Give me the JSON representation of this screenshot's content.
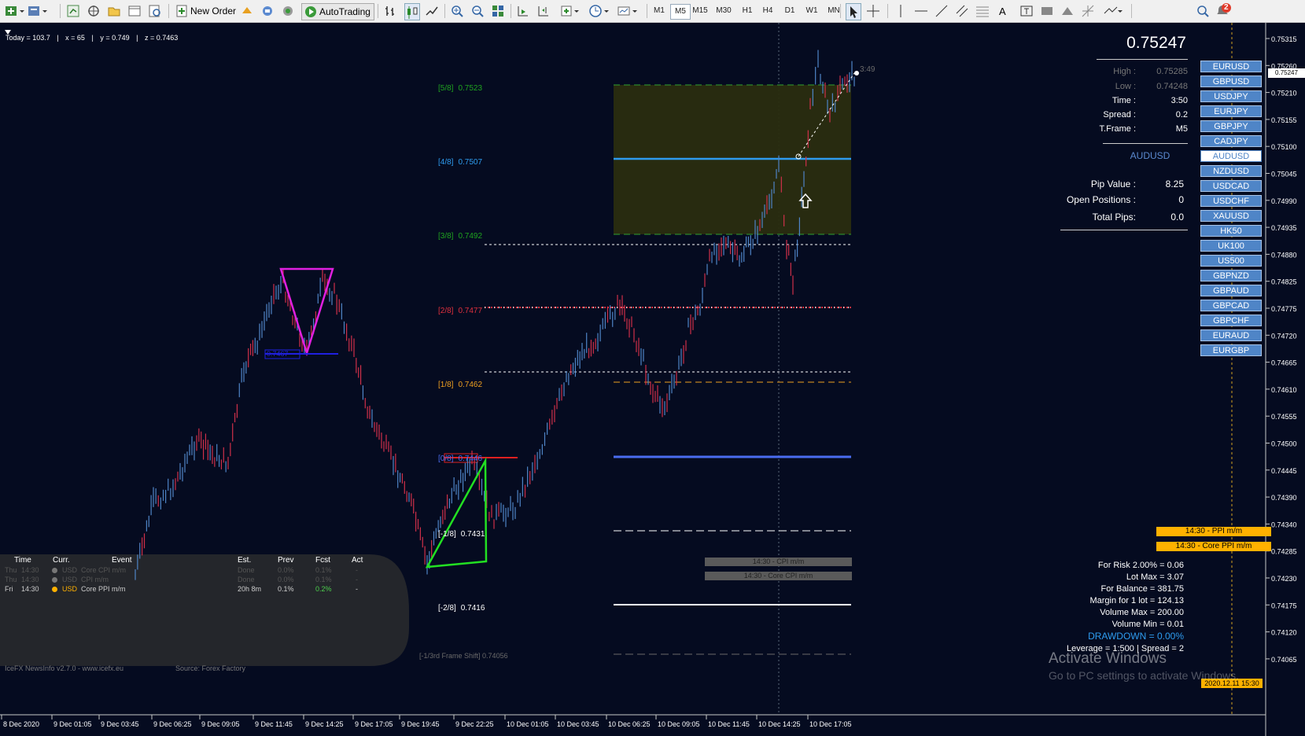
{
  "toolbar": {
    "new_order_label": "New Order",
    "autotrading_label": "AutoTrading",
    "timeframes": [
      "M1",
      "M5",
      "M15",
      "M30",
      "H1",
      "H4",
      "D1",
      "W1",
      "MN"
    ],
    "active_timeframe": "M5",
    "notification_count": "2"
  },
  "crosshair_info": {
    "today": "Today = 103.7",
    "x": "x = 65",
    "y": "y = 0.749",
    "z": "z = 0.7463"
  },
  "price_panel": {
    "bid": "0.75247",
    "high_label": "High :",
    "high_value": "0.75285",
    "low_label": "Low :",
    "low_value": "0.74248",
    "time_label": "Time :",
    "time_value": "3:50",
    "spread_label": "Spread :",
    "spread_value": "0.2",
    "tframe_label": "T.Frame :",
    "tframe_value": "M5",
    "symbol": "AUDUSD",
    "pip_value_label": "Pip Value :",
    "pip_value": "8.25",
    "open_positions_label": "Open Positions :",
    "open_positions": "0",
    "total_pips_label": "Total Pips:",
    "total_pips": "0.0"
  },
  "symbols": [
    "EURUSD",
    "GBPUSD",
    "USDJPY",
    "EURJPY",
    "GBPJPY",
    "CADJPY",
    "AUDUSD",
    "NZDUSD",
    "USDCAD",
    "USDCHF",
    "XAUUSD",
    "HK50",
    "UK100",
    "US500",
    "GBPNZD",
    "GBPAUD",
    "GBPCAD",
    "GBPCHF",
    "EURAUD",
    "EURGBP"
  ],
  "active_symbol": "AUDUSD",
  "murrey": [
    {
      "label": "[5/8]",
      "value": "0.7523",
      "color": "#1fa31f"
    },
    {
      "label": "[4/8]",
      "value": "0.7507",
      "color": "#2e9cf0"
    },
    {
      "label": "[3/8]",
      "value": "0.7492",
      "color": "#1fa31f"
    },
    {
      "label": "[2/8]",
      "value": "0.7477",
      "color": "#e0303e"
    },
    {
      "label": "[1/8]",
      "value": "0.7462",
      "color": "#f0a020"
    },
    {
      "label": "[0/8]",
      "value": "0.7446",
      "color": "#4a6cf0"
    },
    {
      "label": "[-1/8]",
      "value": "0.7431",
      "color": "#ffffff"
    },
    {
      "label": "[-2/8]",
      "value": "0.7416",
      "color": "#ffffff"
    }
  ],
  "frame_shift": {
    "label": "[-1/3rd Frame Shift]",
    "value": "0.74056"
  },
  "pattern_label": "0.7467",
  "candle_timer": "3:49",
  "price_axis": {
    "ticks": [
      "0.75315",
      "0.75260",
      "0.75210",
      "0.75155",
      "0.75100",
      "0.75045",
      "0.74990",
      "0.74935",
      "0.74880",
      "0.74825",
      "0.74775",
      "0.74720",
      "0.74665",
      "0.74610",
      "0.74555",
      "0.74500",
      "0.74445",
      "0.74390",
      "0.74340",
      "0.74285",
      "0.74230",
      "0.74175",
      "0.74120",
      "0.74065"
    ],
    "current_price": "0.75247"
  },
  "time_axis": {
    "labels": [
      "8 Dec 2020",
      "9 Dec 01:05",
      "9 Dec 03:45",
      "9 Dec 06:25",
      "9 Dec 09:05",
      "9 Dec 11:45",
      "9 Dec 14:25",
      "9 Dec 17:05",
      "9 Dec 19:45",
      "9 Dec 22:25",
      "10 Dec 01:05",
      "10 Dec 03:45",
      "10 Dec 06:25",
      "10 Dec 09:05",
      "10 Dec 11:45",
      "10 Dec 14:25",
      "10 Dec 17:05"
    ],
    "current_time": "2020.12.11 15:30"
  },
  "news": {
    "headers": [
      "Time",
      "Curr.",
      "Event",
      "Est.",
      "Prev",
      "Fcst",
      "Act"
    ],
    "rows": [
      {
        "day": "Thu",
        "time": "14:30",
        "dot": "#777777",
        "curr": "USD",
        "event": "Core CPI m/m",
        "est": "Done",
        "prev": "0.0%",
        "fcst": "0.1%",
        "act": "-"
      },
      {
        "day": "Thu",
        "time": "14:30",
        "dot": "#777777",
        "curr": "USD",
        "event": "CPI m/m",
        "est": "Done",
        "prev": "0.0%",
        "fcst": "0.1%",
        "act": "-"
      },
      {
        "day": "Fri",
        "time": "14:30",
        "dot": "#ffb100",
        "curr": "USD",
        "event": "Core PPI m/m",
        "est": "20h 8m",
        "prev": "0.1%",
        "fcst": "0.2%",
        "act": "-"
      }
    ],
    "footer_version": "IceFX NewsInfo v2.7.0  -  www.icefx.eu",
    "footer_source": "Source: Forex Factory"
  },
  "event_labels": {
    "future": [
      "14:30 - PPI m/m",
      "14:30 - Core PPI m/m"
    ],
    "past": [
      "14:30 - CPI m/m",
      "14:30 - Core CPI m/m"
    ]
  },
  "risk": {
    "for_risk": "For Risk 2.00% = 0.06",
    "lot_max": "Lot Max = 3.07",
    "for_balance": "For Balance = 381.75",
    "margin": "Margin for 1 lot = 124.13",
    "volume_max": "Volume Max = 200.00",
    "volume_min": "Volume Min = 0.01",
    "drawdown": "DRAWDOWN =  0.00%",
    "leverage": "Leverage = 1:500 | Spread = 2"
  },
  "watermark": {
    "title": "Activate Windows",
    "subtitle": "Go to PC settings to activate Windows."
  },
  "colors": {
    "background": "#050b20",
    "bull": "#4f85c7",
    "bear": "#d0304a",
    "symbol_button": "#4f85c7",
    "event_highlight": "#ffb100",
    "drawdown": "#2e9cf0"
  }
}
